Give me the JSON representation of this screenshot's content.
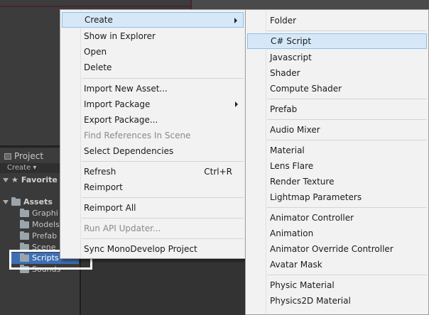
{
  "project_panel": {
    "tab_label": "Project",
    "create_label": "Create ▾",
    "favorites_label": "Favorite",
    "assets_label": "Assets",
    "folders": [
      "Graphi",
      "Models",
      "Prefab",
      "Scene",
      "Scripts",
      "Sounds"
    ]
  },
  "context_menu": {
    "items": [
      {
        "label": "Create",
        "submenu": true,
        "highlight": true
      },
      {
        "label": "Show in Explorer"
      },
      {
        "label": "Open"
      },
      {
        "label": "Delete"
      },
      {
        "label": "Import New Asset..."
      },
      {
        "label": "Import Package",
        "submenu": true
      },
      {
        "label": "Export Package..."
      },
      {
        "label": "Find References In Scene",
        "disabled": true
      },
      {
        "label": "Select Dependencies"
      },
      {
        "label": "Refresh",
        "shortcut": "Ctrl+R"
      },
      {
        "label": "Reimport"
      },
      {
        "label": "Reimport All"
      },
      {
        "label": "Run API Updater...",
        "disabled": true
      },
      {
        "label": "Sync MonoDevelop Project"
      }
    ]
  },
  "create_submenu": {
    "items": [
      {
        "label": "Folder"
      },
      {
        "label": "C# Script",
        "highlight": true
      },
      {
        "label": "Javascript"
      },
      {
        "label": "Shader"
      },
      {
        "label": "Compute Shader"
      },
      {
        "label": "Prefab"
      },
      {
        "label": "Audio Mixer"
      },
      {
        "label": "Material"
      },
      {
        "label": "Lens Flare"
      },
      {
        "label": "Render Texture"
      },
      {
        "label": "Lightmap Parameters"
      },
      {
        "label": "Animator Controller"
      },
      {
        "label": "Animation"
      },
      {
        "label": "Animator Override Controller"
      },
      {
        "label": "Avatar Mask"
      },
      {
        "label": "Physic Material"
      },
      {
        "label": "Physics2D Material"
      }
    ]
  },
  "colors": {
    "menu_bg": "#f2f2f2",
    "highlight_bg": "#d6e8f8",
    "highlight_border": "#8fbfe6",
    "selection_blue": "#3d6fb5",
    "editor_bg": "#3a3a3a"
  }
}
